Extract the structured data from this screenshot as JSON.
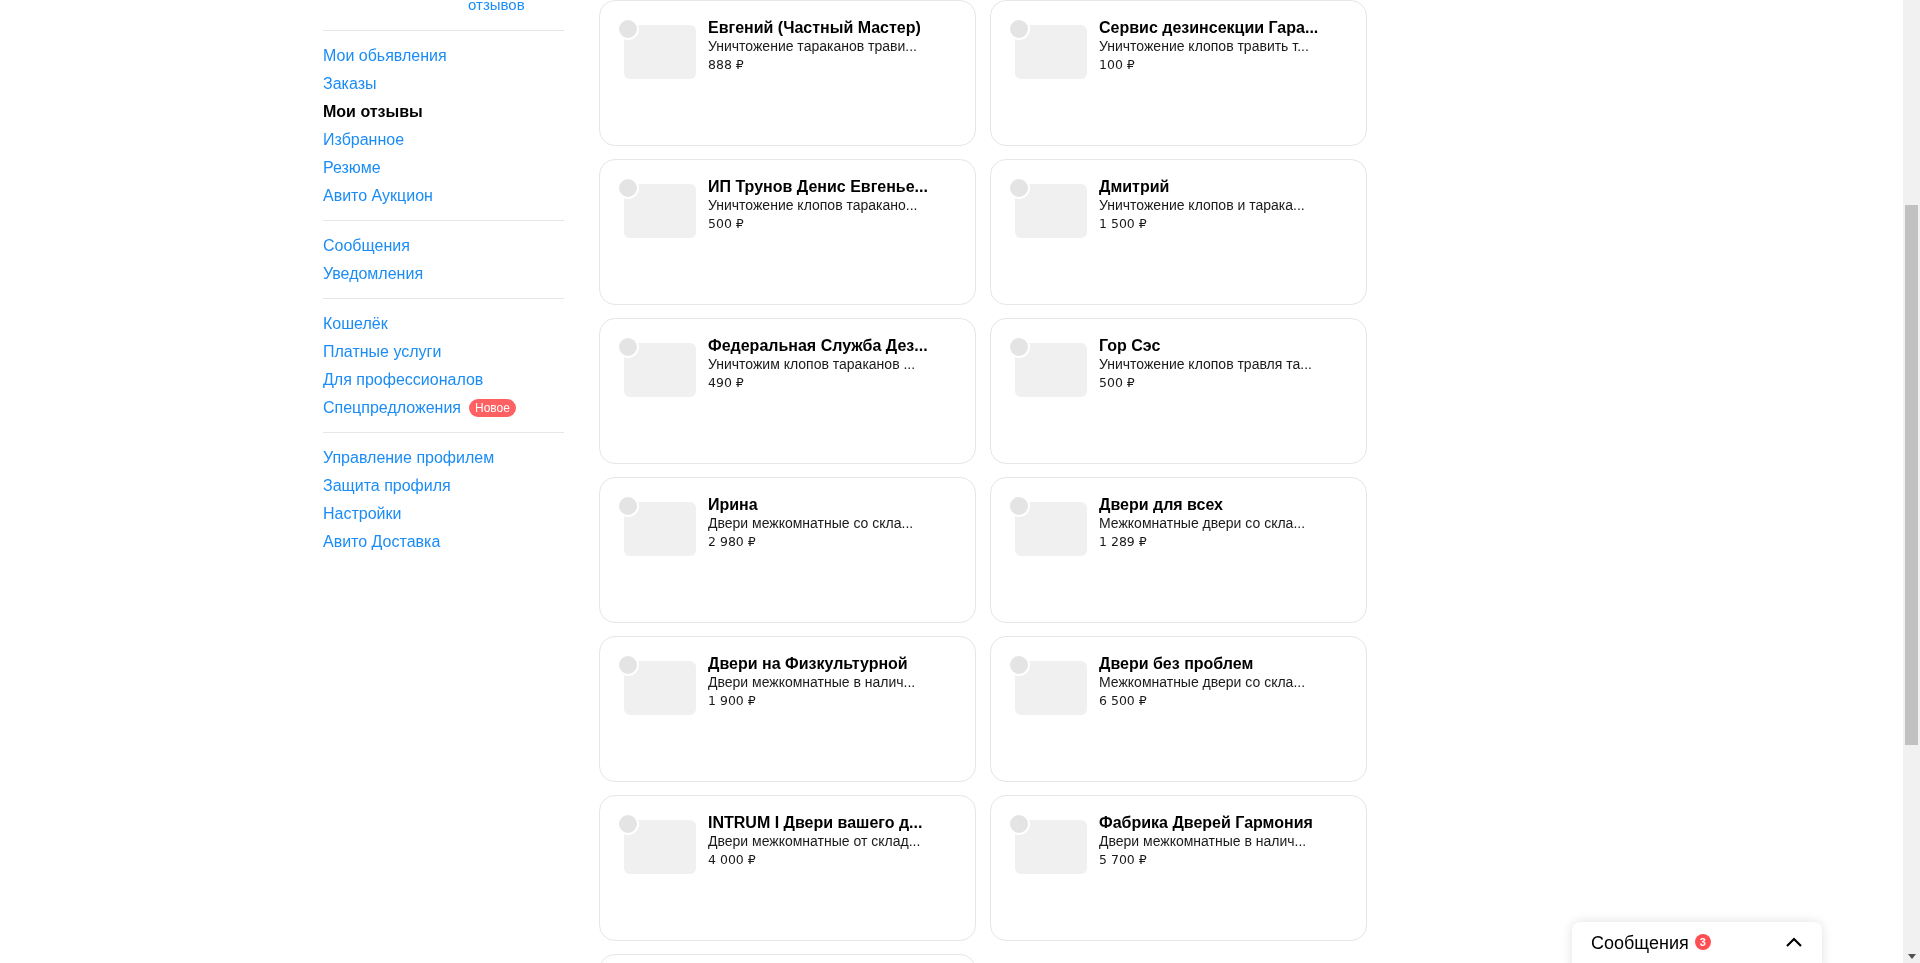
{
  "top_link": "отзывов",
  "sidebar": {
    "groups": [
      [
        {
          "label": "Мои обьявления",
          "selected": false
        },
        {
          "label": "Заказы",
          "selected": false
        },
        {
          "label": "Мои отзывы",
          "selected": true
        },
        {
          "label": "Избранное",
          "selected": false
        },
        {
          "label": "Резюме",
          "selected": false
        },
        {
          "label": "Авито Аукцион",
          "selected": false
        }
      ],
      [
        {
          "label": "Сообщения",
          "selected": false
        },
        {
          "label": "Уведомления",
          "selected": false
        }
      ],
      [
        {
          "label": "Кошелёк",
          "selected": false
        },
        {
          "label": "Платные услуги",
          "selected": false
        },
        {
          "label": "Для профессионалов",
          "selected": false
        },
        {
          "label": "Спецпредложения",
          "selected": false,
          "badge": "Новое"
        }
      ],
      [
        {
          "label": "Управление профилем",
          "selected": false
        },
        {
          "label": "Защита профиля",
          "selected": false
        },
        {
          "label": "Настройки",
          "selected": false
        },
        {
          "label": "Авито Доставка",
          "selected": false
        }
      ]
    ]
  },
  "listings": [
    {
      "title": "Евгений (Частный Мастер)",
      "description": "Уничтожение тараканов трави...",
      "price": "888 ₽"
    },
    {
      "title": "Сервис дезинсекции Гара...",
      "description": "Уничтожение клопов травить т...",
      "price": "100 ₽"
    },
    {
      "title": "ИП Трунов Денис Евгенье...",
      "description": "Уничтожение клопов таракано...",
      "price": "500 ₽"
    },
    {
      "title": "Дмитрий",
      "description": "Уничтожение клопов и тарака...",
      "price": "1 500 ₽"
    },
    {
      "title": "Федеральная Служба Дез...",
      "description": "Уничтожим клопов тараканов ...",
      "price": "490 ₽"
    },
    {
      "title": "Гор Сэс",
      "description": "Уничтожение клопов травля та...",
      "price": "500 ₽"
    },
    {
      "title": "Ирина",
      "description": "Двери межкомнатные со скла...",
      "price": "2 980 ₽"
    },
    {
      "title": "Двери для всех",
      "description": "Межкомнатные двери со скла...",
      "price": "1 289 ₽"
    },
    {
      "title": "Двери на Физкультурной",
      "description": "Двери межкомнатные в налич...",
      "price": "1 900 ₽"
    },
    {
      "title": "Двери без проблем",
      "description": "Межкомнатные двери со скла...",
      "price": "6 500 ₽"
    },
    {
      "title": "INTRUM I Двери вашего д...",
      "description": "Двери межкомнатные от склад...",
      "price": "4 000 ₽"
    },
    {
      "title": "Фабрика Дверей Гармония",
      "description": "Двери межкомнатные в налич...",
      "price": "5 700 ₽"
    }
  ],
  "messages_widget": {
    "label": "Сообщения",
    "badge": "3"
  }
}
